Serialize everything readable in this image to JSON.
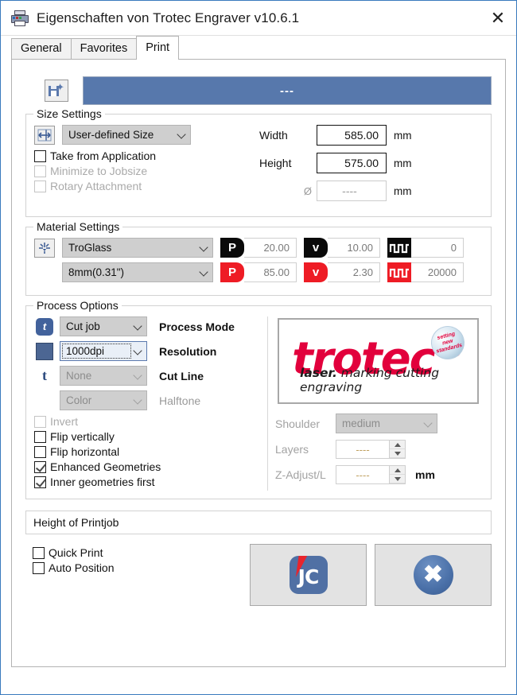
{
  "window": {
    "title": "Eigenschaften von Trotec Engraver v10.6.1",
    "printer_icon": "printer-icon",
    "close_label": "✕"
  },
  "tabs": [
    {
      "label": "General",
      "active": false
    },
    {
      "label": "Favorites",
      "active": false
    },
    {
      "label": "Print",
      "active": true
    }
  ],
  "favorites": {
    "save_icon": "save-favorite-icon",
    "bar_text": "---",
    "bar_color": "#5778ac"
  },
  "size_settings": {
    "legend": "Size Settings",
    "icon": "size-dimensions-icon",
    "preset": "User-defined Size",
    "checkboxes": [
      {
        "label": "Take from Application",
        "checked": false,
        "disabled": false
      },
      {
        "label": "Minimize to Jobsize",
        "checked": false,
        "disabled": true
      },
      {
        "label": "Rotary Attachment",
        "checked": false,
        "disabled": true
      }
    ],
    "width_label": "Width",
    "width_value": "585.00",
    "width_unit": "mm",
    "height_label": "Height",
    "height_value": "575.00",
    "height_unit": "mm",
    "diameter_symbol": "Ø",
    "diameter_value": "----",
    "diameter_unit": "mm"
  },
  "material_settings": {
    "legend": "Material Settings",
    "icon": "laser-material-icon",
    "material": "TroGlass",
    "thickness": "8mm(0.31\")",
    "row1": {
      "power_badge": "P",
      "power_value": "20.00",
      "velocity_badge": "v",
      "velocity_value": "10.00",
      "frequency_badge": "frequency-wave-icon",
      "frequency_value": "0",
      "badge_color": "#0a0a0a"
    },
    "row2": {
      "power_badge": "P",
      "power_value": "85.00",
      "velocity_badge": "v",
      "velocity_value": "2.30",
      "frequency_badge": "frequency-wave-icon",
      "frequency_value": "20000",
      "badge_color": "#ee1c25"
    }
  },
  "process_options": {
    "legend": "Process Options",
    "rows": [
      {
        "icon": "job-type-icon",
        "value": "Cut job",
        "label": "Process Mode",
        "disabled": false,
        "focused": false
      },
      {
        "icon": "color-swatch-icon",
        "value": "1000dpi",
        "label": "Resolution",
        "disabled": false,
        "focused": true
      },
      {
        "icon": "cutline-t-icon",
        "value": "None",
        "label": "Cut Line",
        "disabled": true,
        "focused": false
      },
      {
        "icon": "",
        "value": "Color",
        "label": "Halftone",
        "disabled": true,
        "focused": false
      }
    ],
    "checkboxes": [
      {
        "label": "Invert",
        "checked": false,
        "disabled": true
      },
      {
        "label": "Flip vertically",
        "checked": false,
        "disabled": false
      },
      {
        "label": "Flip horizontal",
        "checked": false,
        "disabled": false
      },
      {
        "label": "Enhanced Geometries",
        "checked": true,
        "disabled": false
      },
      {
        "label": "Inner geometries first",
        "checked": true,
        "disabled": false
      }
    ],
    "logo": {
      "word": "trotec",
      "registered": "®",
      "badge_lines": [
        "setting",
        "new",
        "standards"
      ],
      "tagline_bold": "laser.",
      "tagline_rest": " marking cutting engraving",
      "brand_color": "#e2003c"
    },
    "shoulder_label": "Shoulder",
    "shoulder_value": "medium",
    "layers_label": "Layers",
    "layers_value": "----",
    "zadjust_label": "Z-Adjust/L",
    "zadjust_value": "----",
    "zadjust_unit": "mm"
  },
  "bottom": {
    "height_of_printjob": "Height of Printjob",
    "checkboxes": [
      {
        "label": "Quick Print",
        "checked": false
      },
      {
        "label": "Auto Position",
        "checked": false
      }
    ],
    "jobcontrol_button": "jobcontrol-jc-icon",
    "jobcontrol_text": "JC",
    "cancel_button": "cancel-x-icon",
    "cancel_glyph": "✖"
  }
}
